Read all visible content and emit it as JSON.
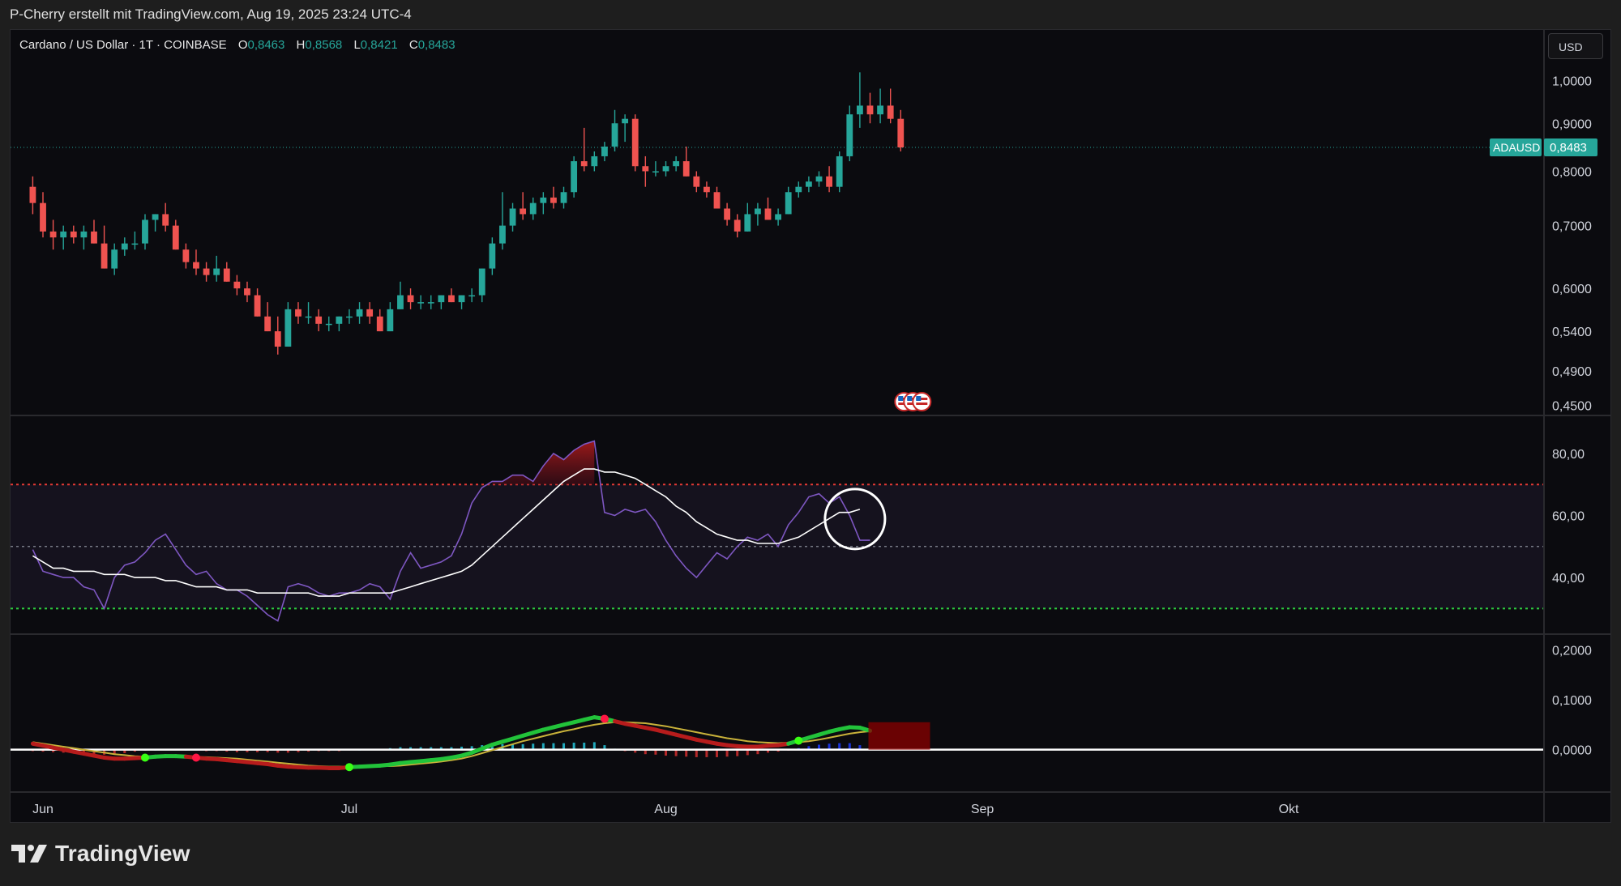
{
  "header": {
    "credit": "P-Cherry erstellt mit TradingView.com, Aug 19, 2025 23:24 UTC-4"
  },
  "legend": {
    "symbol": "Cardano / US Dollar · 1T · COINBASE",
    "o_label": "O",
    "o_value": "0,8463",
    "h_label": "H",
    "h_value": "0,8568",
    "l_label": "L",
    "l_value": "0,8421",
    "c_label": "C",
    "c_value": "0,8483"
  },
  "currency_button": "USD",
  "price_tag": {
    "symbol": "ADAUSD",
    "value": "0,8483"
  },
  "footer": {
    "brand": "TradingView"
  },
  "colors": {
    "up": "#26a69a",
    "down": "#ef5350",
    "rsi": "#7e57c2",
    "rsi_ma": "#ffffff",
    "macd_up": "#22c33a",
    "macd_down": "#b71c1c",
    "signal": "#c9b23a"
  },
  "chart_data": [
    {
      "type": "candlestick",
      "panel": "price",
      "y_scale": "log",
      "ylim": [
        0.44,
        1.06
      ],
      "y_ticks": [
        "1,0000",
        "0,9000",
        "0,8000",
        "0,7000",
        "0,6000",
        "0,5400",
        "0,4900",
        "0,4500"
      ],
      "y_tick_values": [
        1.0,
        0.9,
        0.8,
        0.7,
        0.6,
        0.54,
        0.49,
        0.45
      ],
      "x_ticks": [
        "Jun",
        "Jul",
        "Aug",
        "Sep",
        "Okt"
      ],
      "x_tick_dates": [
        "2025-06-01",
        "2025-07-01",
        "2025-08-01",
        "2025-09-01",
        "2025-10-01"
      ],
      "x_range": [
        "2025-06-01",
        "2025-10-26"
      ],
      "last_price": 0.8483,
      "candles": [
        [
          "2025-05-31",
          0.77,
          0.79,
          0.72,
          0.74
        ],
        [
          "2025-06-01",
          0.74,
          0.76,
          0.68,
          0.69
        ],
        [
          "2025-06-02",
          0.69,
          0.71,
          0.66,
          0.68
        ],
        [
          "2025-06-03",
          0.68,
          0.7,
          0.66,
          0.69
        ],
        [
          "2025-06-04",
          0.69,
          0.7,
          0.67,
          0.68
        ],
        [
          "2025-06-05",
          0.68,
          0.7,
          0.66,
          0.69
        ],
        [
          "2025-06-06",
          0.69,
          0.71,
          0.67,
          0.67
        ],
        [
          "2025-06-07",
          0.67,
          0.7,
          0.63,
          0.63
        ],
        [
          "2025-06-08",
          0.63,
          0.67,
          0.62,
          0.66
        ],
        [
          "2025-06-09",
          0.66,
          0.68,
          0.65,
          0.67
        ],
        [
          "2025-06-10",
          0.67,
          0.69,
          0.66,
          0.67
        ],
        [
          "2025-06-11",
          0.67,
          0.72,
          0.66,
          0.71
        ],
        [
          "2025-06-12",
          0.71,
          0.72,
          0.69,
          0.72
        ],
        [
          "2025-06-13",
          0.72,
          0.74,
          0.69,
          0.7
        ],
        [
          "2025-06-14",
          0.7,
          0.71,
          0.66,
          0.66
        ],
        [
          "2025-06-15",
          0.66,
          0.67,
          0.63,
          0.64
        ],
        [
          "2025-06-16",
          0.64,
          0.66,
          0.62,
          0.63
        ],
        [
          "2025-06-17",
          0.63,
          0.64,
          0.61,
          0.62
        ],
        [
          "2025-06-18",
          0.62,
          0.65,
          0.61,
          0.63
        ],
        [
          "2025-06-19",
          0.63,
          0.64,
          0.61,
          0.61
        ],
        [
          "2025-06-20",
          0.61,
          0.62,
          0.59,
          0.6
        ],
        [
          "2025-06-21",
          0.6,
          0.61,
          0.58,
          0.59
        ],
        [
          "2025-06-22",
          0.59,
          0.6,
          0.56,
          0.56
        ],
        [
          "2025-06-23",
          0.56,
          0.58,
          0.54,
          0.54
        ],
        [
          "2025-06-24",
          0.54,
          0.56,
          0.51,
          0.52
        ],
        [
          "2025-06-25",
          0.52,
          0.58,
          0.52,
          0.57
        ],
        [
          "2025-06-26",
          0.57,
          0.58,
          0.55,
          0.56
        ],
        [
          "2025-06-27",
          0.56,
          0.58,
          0.55,
          0.56
        ],
        [
          "2025-06-28",
          0.56,
          0.57,
          0.54,
          0.55
        ],
        [
          "2025-06-29",
          0.55,
          0.56,
          0.54,
          0.55
        ],
        [
          "2025-06-30",
          0.55,
          0.56,
          0.54,
          0.56
        ],
        [
          "2025-07-01",
          0.56,
          0.57,
          0.55,
          0.56
        ],
        [
          "2025-07-02",
          0.56,
          0.58,
          0.55,
          0.57
        ],
        [
          "2025-07-03",
          0.57,
          0.58,
          0.55,
          0.56
        ],
        [
          "2025-07-04",
          0.56,
          0.57,
          0.54,
          0.54
        ],
        [
          "2025-07-05",
          0.54,
          0.58,
          0.54,
          0.57
        ],
        [
          "2025-07-06",
          0.57,
          0.61,
          0.57,
          0.59
        ],
        [
          "2025-07-07",
          0.59,
          0.6,
          0.57,
          0.58
        ],
        [
          "2025-07-08",
          0.58,
          0.59,
          0.57,
          0.58
        ],
        [
          "2025-07-09",
          0.58,
          0.59,
          0.57,
          0.58
        ],
        [
          "2025-07-10",
          0.58,
          0.59,
          0.57,
          0.59
        ],
        [
          "2025-07-11",
          0.59,
          0.6,
          0.58,
          0.58
        ],
        [
          "2025-07-12",
          0.58,
          0.59,
          0.57,
          0.59
        ],
        [
          "2025-07-13",
          0.59,
          0.6,
          0.58,
          0.59
        ],
        [
          "2025-07-14",
          0.59,
          0.63,
          0.58,
          0.63
        ],
        [
          "2025-07-15",
          0.63,
          0.68,
          0.62,
          0.67
        ],
        [
          "2025-07-16",
          0.67,
          0.76,
          0.66,
          0.7
        ],
        [
          "2025-07-17",
          0.7,
          0.74,
          0.69,
          0.73
        ],
        [
          "2025-07-18",
          0.73,
          0.76,
          0.71,
          0.72
        ],
        [
          "2025-07-19",
          0.72,
          0.75,
          0.71,
          0.74
        ],
        [
          "2025-07-20",
          0.74,
          0.76,
          0.72,
          0.75
        ],
        [
          "2025-07-21",
          0.75,
          0.77,
          0.73,
          0.74
        ],
        [
          "2025-07-22",
          0.74,
          0.77,
          0.73,
          0.76
        ],
        [
          "2025-07-23",
          0.76,
          0.83,
          0.75,
          0.82
        ],
        [
          "2025-07-24",
          0.82,
          0.89,
          0.8,
          0.81
        ],
        [
          "2025-07-25",
          0.81,
          0.84,
          0.8,
          0.83
        ],
        [
          "2025-07-26",
          0.83,
          0.86,
          0.82,
          0.85
        ],
        [
          "2025-07-27",
          0.85,
          0.93,
          0.84,
          0.9
        ],
        [
          "2025-07-28",
          0.9,
          0.92,
          0.86,
          0.91
        ],
        [
          "2025-07-29",
          0.91,
          0.92,
          0.8,
          0.81
        ],
        [
          "2025-07-30",
          0.81,
          0.83,
          0.77,
          0.8
        ],
        [
          "2025-07-31",
          0.8,
          0.82,
          0.79,
          0.8
        ],
        [
          "2025-08-01",
          0.8,
          0.82,
          0.79,
          0.81
        ],
        [
          "2025-08-02",
          0.81,
          0.83,
          0.8,
          0.82
        ],
        [
          "2025-08-03",
          0.82,
          0.85,
          0.79,
          0.79
        ],
        [
          "2025-08-04",
          0.79,
          0.8,
          0.76,
          0.77
        ],
        [
          "2025-08-05",
          0.77,
          0.78,
          0.75,
          0.76
        ],
        [
          "2025-08-06",
          0.76,
          0.77,
          0.73,
          0.73
        ],
        [
          "2025-08-07",
          0.73,
          0.74,
          0.7,
          0.71
        ],
        [
          "2025-08-08",
          0.71,
          0.72,
          0.68,
          0.69
        ],
        [
          "2025-08-09",
          0.69,
          0.74,
          0.69,
          0.72
        ],
        [
          "2025-08-10",
          0.72,
          0.74,
          0.7,
          0.73
        ],
        [
          "2025-08-11",
          0.73,
          0.75,
          0.71,
          0.71
        ],
        [
          "2025-08-12",
          0.71,
          0.73,
          0.7,
          0.72
        ],
        [
          "2025-08-13",
          0.72,
          0.77,
          0.72,
          0.76
        ],
        [
          "2025-08-14",
          0.76,
          0.78,
          0.75,
          0.77
        ],
        [
          "2025-08-15",
          0.77,
          0.79,
          0.76,
          0.78
        ],
        [
          "2025-08-16",
          0.78,
          0.8,
          0.77,
          0.79
        ],
        [
          "2025-08-17",
          0.79,
          0.81,
          0.76,
          0.77
        ],
        [
          "2025-08-18",
          0.77,
          0.84,
          0.76,
          0.83
        ],
        [
          "2025-08-19",
          0.83,
          0.94,
          0.82,
          0.92
        ],
        [
          "2025-08-20",
          0.92,
          1.02,
          0.89,
          0.94
        ],
        [
          "2025-08-21",
          0.94,
          0.97,
          0.9,
          0.92
        ],
        [
          "2025-08-22",
          0.92,
          0.98,
          0.9,
          0.94
        ],
        [
          "2025-08-23",
          0.94,
          0.98,
          0.9,
          0.91
        ],
        [
          "2025-08-24",
          0.91,
          0.93,
          0.84,
          0.8483
        ]
      ]
    },
    {
      "type": "line",
      "panel": "rsi",
      "ylim": [
        22,
        92
      ],
      "y_ticks": [
        "80,00",
        "60,00",
        "40,00"
      ],
      "y_tick_values": [
        80,
        60,
        40
      ],
      "bands": {
        "upper": 70,
        "middle": 50,
        "lower": 30
      },
      "series": [
        {
          "values": [
            49,
            42,
            41,
            40,
            40,
            37,
            36,
            30,
            40,
            44,
            45,
            48,
            52,
            54,
            49,
            44,
            41,
            42,
            38,
            36,
            36,
            34,
            31,
            28,
            26,
            37,
            38,
            37,
            35,
            34,
            35,
            35,
            36,
            38,
            37,
            33,
            42,
            48,
            43,
            44,
            45,
            47,
            54,
            64,
            69,
            71,
            71,
            73,
            73,
            71,
            76,
            80,
            78,
            81,
            83,
            84,
            61,
            60,
            62,
            61,
            62,
            58,
            52,
            47,
            43,
            40,
            44,
            48,
            46,
            50,
            53,
            52,
            54,
            50,
            57,
            61,
            66,
            67,
            64,
            66,
            60,
            52,
            52
          ]
        },
        {
          "values": [
            47,
            45,
            43,
            43,
            42,
            42,
            42,
            41,
            41,
            41,
            40,
            40,
            40,
            39,
            39,
            38,
            37,
            37,
            37,
            36,
            36,
            36,
            35,
            35,
            35,
            35,
            35,
            35,
            34,
            34,
            34,
            35,
            35,
            35,
            35,
            35,
            36,
            37,
            38,
            39,
            40,
            41,
            42,
            44,
            47,
            50,
            53,
            56,
            59,
            62,
            65,
            68,
            71,
            73,
            75,
            75,
            74,
            74,
            73,
            72,
            70,
            68,
            66,
            63,
            61,
            58,
            56,
            54,
            53,
            52,
            52,
            51,
            51,
            51,
            52,
            53,
            55,
            57,
            59,
            61,
            61,
            62
          ]
        }
      ]
    },
    {
      "type": "bar",
      "panel": "macd",
      "ylim": [
        -0.085,
        0.23
      ],
      "y_ticks": [
        "0,2000",
        "0,1000",
        "0,0000"
      ],
      "y_tick_values": [
        0.2,
        0.1,
        0.0
      ],
      "series": [
        {
          "values": [
            0.012,
            0.008,
            0.004,
            0.0,
            -0.004,
            -0.008,
            -0.012,
            -0.016,
            -0.018,
            -0.018,
            -0.017,
            -0.016,
            -0.014,
            -0.013,
            -0.013,
            -0.014,
            -0.016,
            -0.018,
            -0.019,
            -0.021,
            -0.023,
            -0.025,
            -0.027,
            -0.029,
            -0.032,
            -0.034,
            -0.035,
            -0.036,
            -0.036,
            -0.037,
            -0.037,
            -0.035,
            -0.034,
            -0.033,
            -0.032,
            -0.03,
            -0.027,
            -0.025,
            -0.023,
            -0.021,
            -0.019,
            -0.016,
            -0.012,
            -0.006,
            0.002,
            0.01,
            0.016,
            0.022,
            0.028,
            0.034,
            0.04,
            0.045,
            0.05,
            0.055,
            0.06,
            0.065,
            0.062,
            0.057,
            0.052,
            0.048,
            0.044,
            0.04,
            0.035,
            0.03,
            0.025,
            0.02,
            0.016,
            0.012,
            0.009,
            0.007,
            0.006,
            0.006,
            0.008,
            0.009,
            0.012,
            0.018,
            0.024,
            0.03,
            0.036,
            0.041,
            0.045,
            0.044,
            0.038
          ]
        },
        {
          "values": [
            0.015,
            0.012,
            0.009,
            0.006,
            0.003,
            0.0,
            -0.003,
            -0.006,
            -0.009,
            -0.011,
            -0.013,
            -0.014,
            -0.014,
            -0.014,
            -0.014,
            -0.014,
            -0.015,
            -0.015,
            -0.016,
            -0.017,
            -0.018,
            -0.02,
            -0.022,
            -0.024,
            -0.026,
            -0.028,
            -0.03,
            -0.032,
            -0.033,
            -0.034,
            -0.034,
            -0.034,
            -0.034,
            -0.034,
            -0.033,
            -0.033,
            -0.032,
            -0.03,
            -0.028,
            -0.026,
            -0.024,
            -0.021,
            -0.018,
            -0.013,
            -0.007,
            -0.001,
            0.005,
            0.011,
            0.017,
            0.022,
            0.027,
            0.032,
            0.037,
            0.041,
            0.046,
            0.05,
            0.053,
            0.055,
            0.055,
            0.054,
            0.053,
            0.05,
            0.047,
            0.043,
            0.039,
            0.035,
            0.031,
            0.027,
            0.023,
            0.02,
            0.017,
            0.015,
            0.014,
            0.013,
            0.014,
            0.015,
            0.017,
            0.02,
            0.024,
            0.028,
            0.032,
            0.035,
            0.037
          ]
        },
        {
          "values": [
            -0.003,
            -0.004,
            -0.005,
            -0.006,
            -0.007,
            -0.008,
            -0.009,
            -0.01,
            -0.009,
            -0.007,
            -0.004,
            -0.002,
            0.0,
            0.001,
            0.001,
            0.0,
            -0.001,
            -0.003,
            -0.003,
            -0.004,
            -0.005,
            -0.005,
            -0.005,
            -0.005,
            -0.006,
            -0.006,
            -0.005,
            -0.004,
            -0.003,
            -0.003,
            -0.003,
            -0.001,
            0.0,
            0.001,
            0.001,
            0.003,
            0.005,
            0.005,
            0.005,
            0.005,
            0.005,
            0.005,
            0.006,
            0.007,
            0.009,
            0.011,
            0.011,
            0.011,
            0.011,
            0.012,
            0.013,
            0.013,
            0.013,
            0.014,
            0.014,
            0.015,
            0.009,
            0.002,
            -0.003,
            -0.006,
            -0.009,
            -0.01,
            -0.012,
            -0.013,
            -0.014,
            -0.015,
            -0.015,
            -0.015,
            -0.014,
            -0.013,
            -0.011,
            -0.009,
            -0.006,
            -0.004,
            -0.002,
            0.003,
            0.007,
            0.01,
            0.012,
            0.013,
            0.013,
            0.009,
            0.001
          ]
        }
      ],
      "cross_up": [
        11,
        31,
        75
      ],
      "cross_down": [
        16,
        56
      ]
    }
  ]
}
